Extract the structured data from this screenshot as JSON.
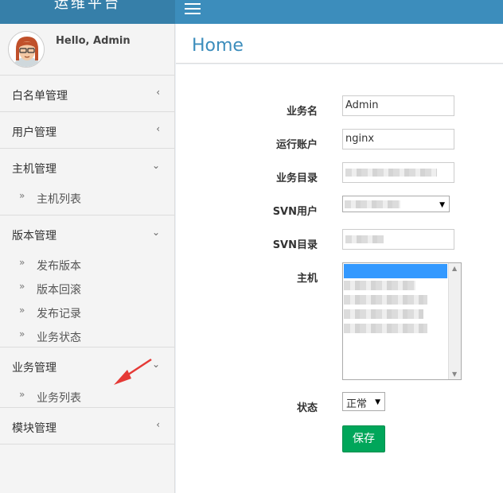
{
  "app": {
    "title": "运维平台",
    "user_greeting": "Hello, Admin"
  },
  "sidebar": {
    "menus": [
      {
        "label": "白名单管理",
        "chevron": "<"
      },
      {
        "label": "用户管理",
        "chevron": "<"
      },
      {
        "label": "主机管理",
        "chevron": "v",
        "items": [
          "主机列表"
        ]
      },
      {
        "label": "版本管理",
        "chevron": "v",
        "items": [
          "发布版本",
          "版本回滚",
          "发布记录",
          "业务状态"
        ]
      },
      {
        "label": "业务管理",
        "chevron": "v",
        "items": [
          "业务列表"
        ]
      },
      {
        "label": "模块管理",
        "chevron": "<"
      }
    ]
  },
  "page": {
    "title": "Home"
  },
  "form": {
    "fields": {
      "business_name": {
        "label": "业务名",
        "value": "Admin"
      },
      "run_account": {
        "label": "运行账户",
        "value": "nginx"
      },
      "business_dir": {
        "label": "业务目录"
      },
      "svn_user": {
        "label": "SVN用户"
      },
      "svn_dir": {
        "label": "SVN目录"
      },
      "hosts": {
        "label": "主机"
      },
      "status": {
        "label": "状态",
        "value": "正常"
      }
    },
    "save_label": "保存"
  },
  "colors": {
    "topbar": "#3c8dbc",
    "accent": "#3c8dbc",
    "save": "#00a65a",
    "selection": "#3399ff",
    "annotation": "#e53935"
  },
  "icons": {
    "menu": "hamburger-icon",
    "collapsed": "chevron-left-icon",
    "expanded": "chevron-down-icon",
    "subitem": "double-chevron-right-icon"
  }
}
